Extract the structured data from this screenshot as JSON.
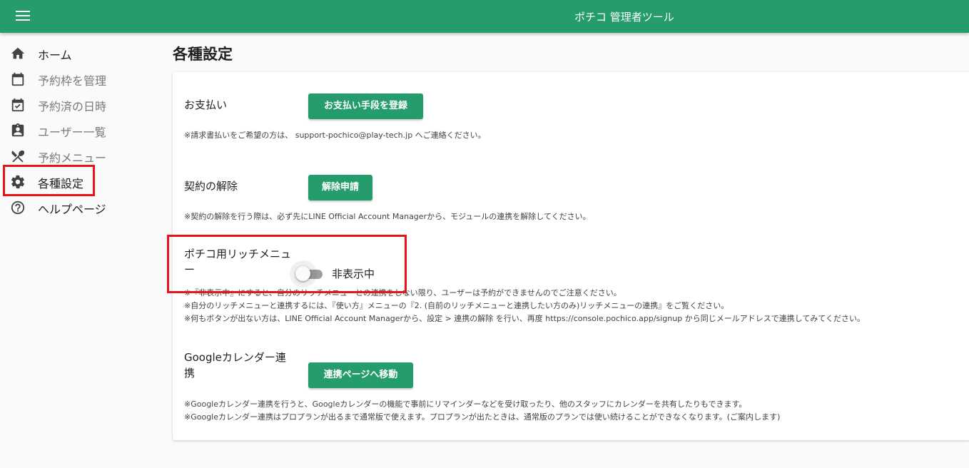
{
  "header": {
    "title": "ポチコ 管理者ツール",
    "menu_icon": "hamburger-menu-icon"
  },
  "sidebar": {
    "items": [
      {
        "label": "ホーム",
        "icon": "home-icon"
      },
      {
        "label": "予約枠を管理",
        "icon": "calendar-icon"
      },
      {
        "label": "予約済の日時",
        "icon": "calendar-check-icon"
      },
      {
        "label": "ユーザー一覧",
        "icon": "clipboard-user-icon"
      },
      {
        "label": "予約メニュー",
        "icon": "utensils-icon"
      },
      {
        "label": "各種設定",
        "icon": "gear-icon"
      },
      {
        "label": "ヘルプページ",
        "icon": "help-circle-icon"
      }
    ]
  },
  "main": {
    "title": "各種設定",
    "payment": {
      "label": "お支払い",
      "button": "お支払い手段を登録",
      "note": "※請求書払いをご希望の方は、 support-pochico@play-tech.jp へご連絡ください。"
    },
    "cancel": {
      "label": "契約の解除",
      "button": "解除申請",
      "note": "※契約の解除を行う際は、必ず先にLINE Official Account Managerから、モジュールの連携を解除してください。"
    },
    "richmenu": {
      "label_line1": "ポチコ用リッチメニュ",
      "label_line2": "ー",
      "toggle_state": "off",
      "toggle_label": "非表示中",
      "notes": [
        "※『非表示中』にすると、自分のリッチメニューとの連携をしない限り、ユーザーは予約ができませんのでご注意ください。",
        "※自分のリッチメニューと連携するには、『使い方』メニューの『2. (自前のリッチメニューと連携したい方のみ)リッチメニューの連携』をご覧ください。",
        "※何もボタンが出ない方は、LINE Official Account Managerから、設定 > 連携の解除 を行い、再度 https://console.pochico.app/signup から同じメールアドレスで連携してみてください。"
      ]
    },
    "google": {
      "label_line1": "Googleカレンダー連",
      "label_line2": "携",
      "button": "連携ページへ移動",
      "notes": [
        "※Googleカレンダー連携を行うと、Googleカレンダーの機能で事前にリマインダーなどを受け取ったり、他のスタッフにカレンダーを共有したりもできます。",
        "※Googleカレンダー連携はプロプランが出るまで通常版で使えます。プロプランが出たときは、通常版のプランでは使い続けることができなくなります。(ご案内します)"
      ]
    }
  },
  "colors": {
    "primary": "#259c6b",
    "highlight": "#e8141b"
  }
}
